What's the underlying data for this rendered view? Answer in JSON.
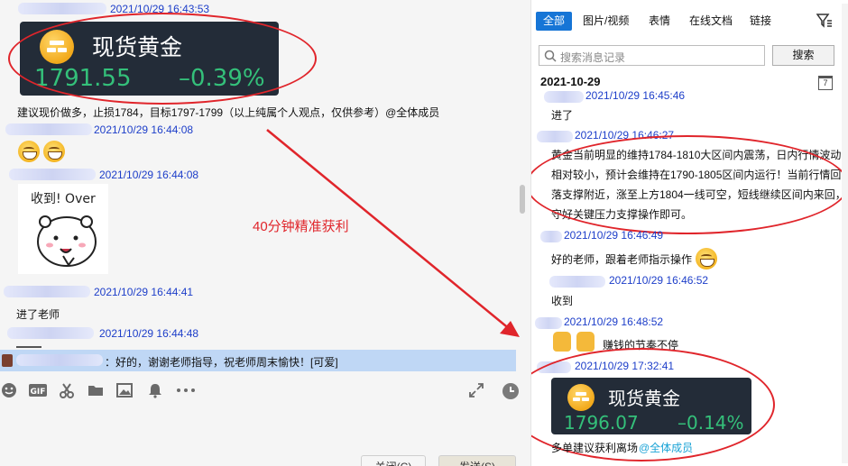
{
  "left_chat": {
    "timestamps": [
      "2021/10/29 16:43:53",
      "2021/10/29 16:44:08",
      "2021/10/29 16:44:08",
      "2021/10/29 16:44:41",
      "2021/10/29 16:44:48"
    ],
    "card": {
      "title": "现货黄金",
      "price": "1791.55",
      "change": "–0.39%"
    },
    "advice": "建议现价做多，止损1784，目标1797-1799（以上纯属个人观点，仅供参考）@全体成员",
    "sticker_text": "收到! Over",
    "joined": "进了老师",
    "annotation": "40分钟精准获利",
    "reply": "：好的，谢谢老师指导，祝老师周末愉快！[可爱]",
    "buttons": {
      "close": "关闭(C)",
      "send": "发送(S)"
    }
  },
  "history": {
    "tabs": [
      "全部",
      "图片/视频",
      "表情",
      "在线文档",
      "链接"
    ],
    "search_placeholder": "搜索消息记录",
    "search_button": "搜索",
    "date": "2021-10-29",
    "calendar_day": "7",
    "entries": [
      {
        "time": "2021/10/29 16:45:46",
        "text": "进了"
      },
      {
        "time": "2021/10/29 16:46:27",
        "text": "黄金当前明显的维持1784-1810大区间内震荡，日内行情波动相对较小，预计会维持在1790-1805区间内运行！当前行情回落支撑附近，涨至上方1804一线可空，短线继续区间内来回，守好关键压力支撑操作即可。"
      },
      {
        "time": "2021/10/29 16:46:49",
        "text": "好的老师，跟着老师指示操作"
      },
      {
        "time": "2021/10/29 16:46:52",
        "text": "收到"
      },
      {
        "time": "2021/10/29 16:48:52",
        "text": "赚钱的节奏不停"
      },
      {
        "time": "2021/10/29 17:32:41",
        "text": ""
      }
    ],
    "card": {
      "title": "现货黄金",
      "price": "1796.07",
      "change": "–0.14%"
    },
    "last_text": "多单建议获利离场",
    "last_mention": "@全体成员"
  }
}
